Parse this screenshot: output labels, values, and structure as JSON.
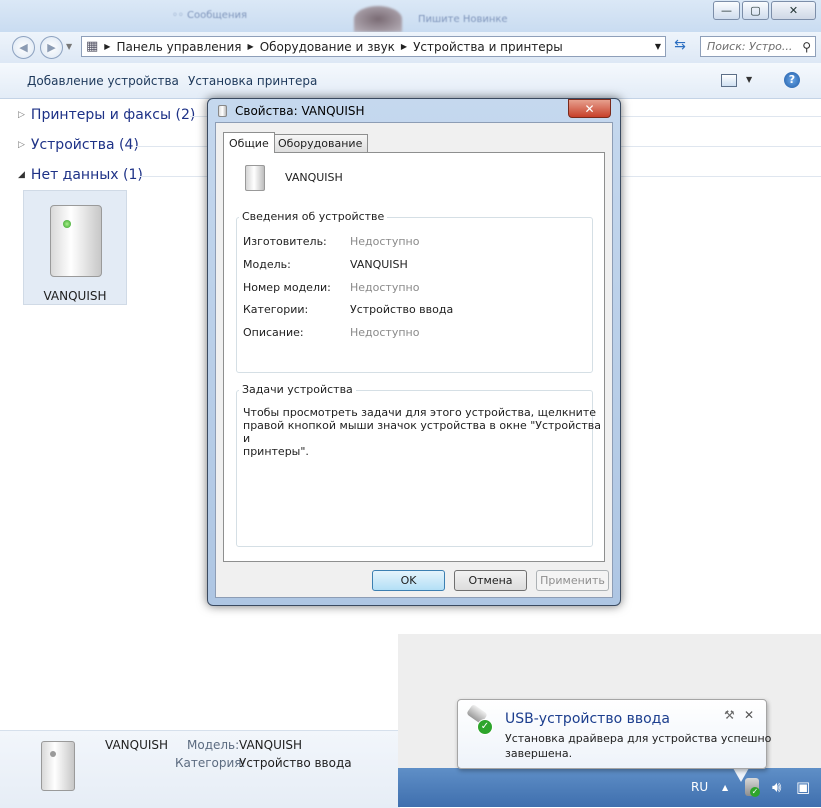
{
  "window_title_blur": [
    "Сообщения",
    "Пишите Новинке"
  ],
  "window_controls": {
    "minimize": "—",
    "maximize": "▢",
    "close": "✕"
  },
  "address": {
    "crumbs": [
      "Панель управления",
      "Оборудование и звук",
      "Устройства и принтеры"
    ],
    "search_placeholder": "Поиск: Устро..."
  },
  "toolbar": {
    "add_device": "Добавление устройства",
    "add_printer": "Установка принтера",
    "help": "?"
  },
  "groups": [
    {
      "label": "Принтеры и факсы (2)",
      "expanded": false
    },
    {
      "label": "Устройства (4)",
      "expanded": false
    },
    {
      "label": "Нет данных (1)",
      "expanded": true
    }
  ],
  "device_tile": {
    "name": "VANQUISH"
  },
  "details": {
    "name": "VANQUISH",
    "model_label": "Модель:",
    "model_value": "VANQUISH",
    "category_label": "Категория:",
    "category_value": "Устройство ввода"
  },
  "dialog": {
    "title": "Свойства: VANQUISH",
    "close": "✕",
    "tabs": [
      "Общие",
      "Оборудование"
    ],
    "device_name": "VANQUISH",
    "info_group": "Сведения об устройстве",
    "fields": [
      {
        "label": "Изготовитель:",
        "value": "Недоступно",
        "muted": true
      },
      {
        "label": "Модель:",
        "value": "VANQUISH",
        "muted": false
      },
      {
        "label": "Номер модели:",
        "value": "Недоступно",
        "muted": true
      },
      {
        "label": "Категории:",
        "value": "Устройство ввода",
        "muted": false
      },
      {
        "label": "Описание:",
        "value": "Недоступно",
        "muted": true
      }
    ],
    "tasks_group": "Задачи устройства",
    "tasks_text": [
      "Чтобы просмотреть задачи для этого устройства, щелкните",
      "правой кнопкой мыши значок устройства в окне \"Устройства и",
      "принтеры\"."
    ],
    "buttons": {
      "ok": "OK",
      "cancel": "Отмена",
      "apply": "Применить"
    }
  },
  "notification": {
    "title": "USB-устройство ввода",
    "line1": "Установка драйвера для устройства успешно",
    "line2": "завершена.",
    "close": "✕"
  },
  "tray": {
    "language": "RU",
    "show_hidden": "▲"
  },
  "colors": {
    "link_blue": "#1e3287",
    "balloon_title": "#1c3e8e"
  }
}
